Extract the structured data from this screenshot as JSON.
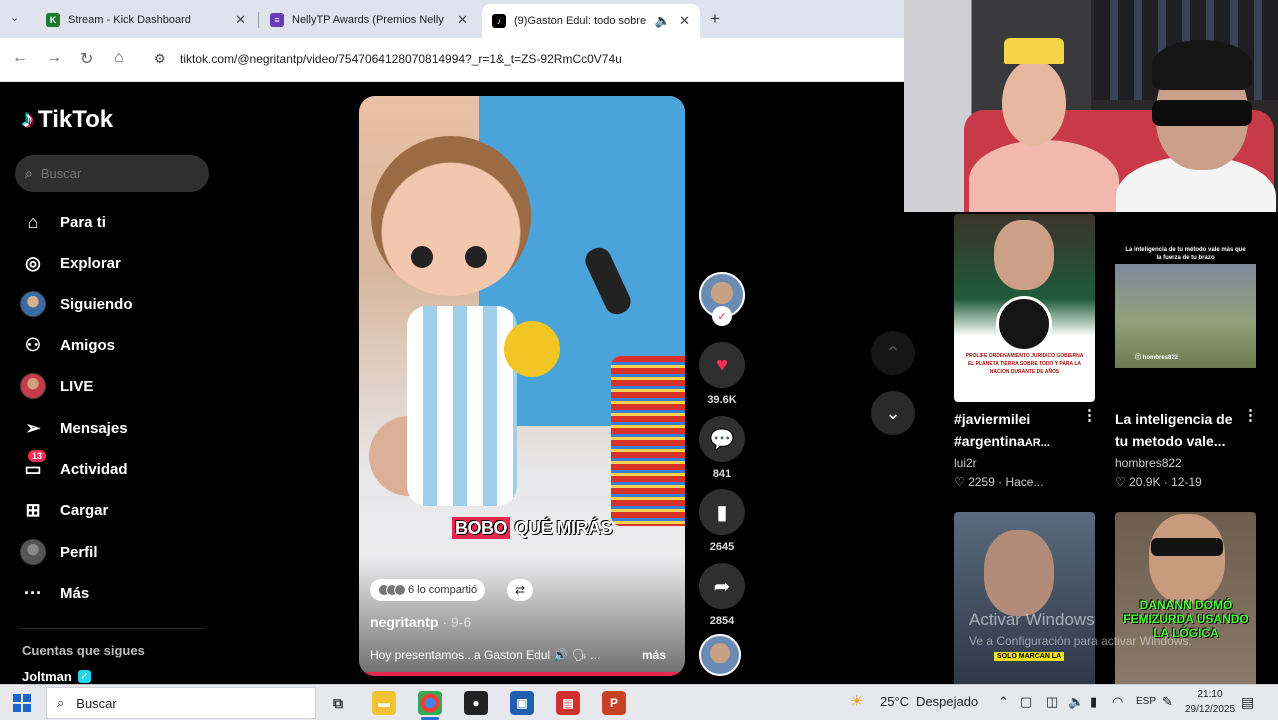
{
  "browser": {
    "tabs": [
      {
        "title": "Stream - Kick Dashboard",
        "icon": "kick-icon",
        "color": "#1b7a2e",
        "glyph": "K"
      },
      {
        "title": "NellyTP Awards (Premios Nelly",
        "icon": "forms-icon",
        "color": "#673ab7",
        "glyph": "≡"
      },
      {
        "title": "(9)Gaston Edul: todo sobre",
        "icon": "tiktok-icon",
        "color": "#000000",
        "glyph": "♪"
      }
    ],
    "url": "tiktok.com/@negritantp/video/7547064128070814994?_r=1&_t=ZS-92RmCc0V74u"
  },
  "sidebar": {
    "brand": "TikTok",
    "search_placeholder": "Buscar",
    "items": [
      {
        "label": "Para ti",
        "icon": "home-icon",
        "glyph": "⌂"
      },
      {
        "label": "Explorar",
        "icon": "compass-icon",
        "glyph": "◎"
      },
      {
        "label": "Siguiendo",
        "icon": "following-avatar-icon",
        "glyph": ""
      },
      {
        "label": "Amigos",
        "icon": "friends-icon",
        "glyph": "⚇"
      },
      {
        "label": "LIVE",
        "icon": "live-avatar-icon",
        "glyph": ""
      },
      {
        "label": "Mensajes",
        "icon": "send-icon",
        "glyph": "➢"
      },
      {
        "label": "Actividad",
        "icon": "inbox-icon",
        "glyph": "▭",
        "badge": "13"
      },
      {
        "label": "Cargar",
        "icon": "upload-icon",
        "glyph": "⊞"
      },
      {
        "label": "Perfil",
        "icon": "profile-avatar-icon",
        "glyph": ""
      },
      {
        "label": "Más",
        "icon": "more-icon",
        "glyph": "···"
      }
    ],
    "following_header": "Cuentas que sigues",
    "following_first": "Joltman"
  },
  "video": {
    "caption_sticker_part1": "BOBO",
    "caption_sticker_part2": "QUÉ MIRÁS",
    "shared_text": "6 lo compartió",
    "author": "negritantp",
    "date": "· 9-6",
    "description": "Hoy presentamos...a Gaston Edul 🔊 🗣 ...",
    "more": "más"
  },
  "actions": {
    "likes": "39.6K",
    "comments": "841",
    "saves": "2645",
    "shares": "2854"
  },
  "recommendations": [
    {
      "title": "#javiermilei #argentina",
      "title_tail": "AR...",
      "user": "lui2r",
      "meta": "♡ 2259 · Hace...",
      "thumb_text": "PROLIFE ORDENAMIENTO JURIDICO GOBIERNA EL PLANETA TIERRA SOBRE TODO Y PARA LA NACION DURANTE DE AÑOS"
    },
    {
      "title": "La inteligencia de tu metodo vale...",
      "title_tail": "",
      "user": "hombres822",
      "meta": "♡ 20.9K · 12-19",
      "thumb_text": "La inteligencia de tu método vale más que la fuerza de tu brazo",
      "thumb_cap": "Ⓣ hombres822"
    },
    {
      "title": "",
      "user": "",
      "meta": "",
      "thumb_cap": "SOLO MARCAN LA"
    },
    {
      "title": "",
      "user": "",
      "meta": "",
      "thumb_cap": "DANANN DOMÓ FEMIZURDA USANDO LA LÓGICA"
    }
  ],
  "watermark": {
    "line1": "Activar Windows",
    "line2": "Ve a Configuración para activar Windows."
  },
  "taskbar": {
    "search": "Buscar",
    "weather": "25°C",
    "weather_desc": "Despejado",
    "lang": "ESP",
    "time": "21:10",
    "date": "29/12/2025"
  },
  "colors": {
    "accent": "#fe2c55",
    "tiktok_cyan": "#25f4ee",
    "background": "#000000"
  }
}
